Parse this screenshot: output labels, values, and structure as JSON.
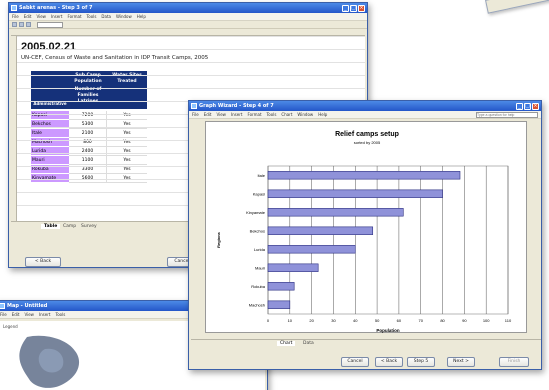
{
  "spreadsheet": {
    "title": "Sabkt arenas - Step 3 of 7",
    "menu": [
      "File",
      "Edit",
      "View",
      "Insert",
      "Format",
      "Tools",
      "Data",
      "Window",
      "Help"
    ],
    "date": "2005.02.21",
    "subtitle": "UN-CEF, Census of Waste and Sanitation in IDP Transit Camps, 2005",
    "table_headers": [
      "Sub Camp Population",
      "Number of Families",
      "Latrines"
    ],
    "table_header_b": "Water Sites Treated",
    "row_header": "Administrative",
    "rows": [
      {
        "name": "Kapasi",
        "v": "7200",
        "ok": "Yes"
      },
      {
        "name": "Bekchos",
        "v": "5300",
        "ok": "Yes"
      },
      {
        "name": "Itale",
        "v": "2100",
        "ok": "Yes"
      },
      {
        "name": "Machosh",
        "v": "800",
        "ok": "Yes"
      },
      {
        "name": "Lurida",
        "v": "2400",
        "ok": "Yes"
      },
      {
        "name": "Mauri",
        "v": "1100",
        "ok": "Yes"
      },
      {
        "name": "Rokuba",
        "v": "3300",
        "ok": "Yes"
      },
      {
        "name": "Kinyamate",
        "v": "5600",
        "ok": "Yes"
      }
    ],
    "sheet_tabs": [
      "Table",
      "Camp",
      "Survey"
    ],
    "back_button": "< Back",
    "cancel_button": "Cancel"
  },
  "chart_window": {
    "title": "Graph Wizard - Step 4 of 7",
    "menu": [
      "File",
      "Edit",
      "View",
      "Insert",
      "Format",
      "Tools",
      "Chart",
      "Window",
      "Help"
    ],
    "search_placeholder": "Type a question for help",
    "sheet_tabs": [
      "Chart",
      "Data"
    ],
    "buttons": {
      "cancel": "Cancel",
      "back": "< Back",
      "step": "Step 5",
      "next": "Next >",
      "finish": "Finish"
    }
  },
  "chart_data": {
    "type": "bar",
    "title": "Relief camps setup",
    "subtitle": "sorted by 2005",
    "categories": [
      "Itale",
      "Kapasi",
      "Kinyamate",
      "Bekchos",
      "Lurida",
      "Mauri",
      "Rokuba",
      "Machosh"
    ],
    "values": [
      88,
      80,
      62,
      48,
      40,
      23,
      12,
      10
    ],
    "xlim": [
      0,
      110
    ],
    "xticks": [
      "0",
      "10",
      "20",
      "30",
      "40",
      "50",
      "60",
      "70",
      "80",
      "90",
      "100",
      "110"
    ],
    "ylabel": "Regions",
    "xlabel": "Population",
    "bar_color": "#8f92d9",
    "grid": true
  },
  "map_window": {
    "title": "Map - Untitled",
    "menu": [
      "File",
      "Edit",
      "View",
      "Insert",
      "Tools"
    ],
    "label": "Legend"
  },
  "colors": {
    "title_bar": "#2456c8",
    "header_fill": "#15317a",
    "name_fill": "#cc99ff"
  }
}
